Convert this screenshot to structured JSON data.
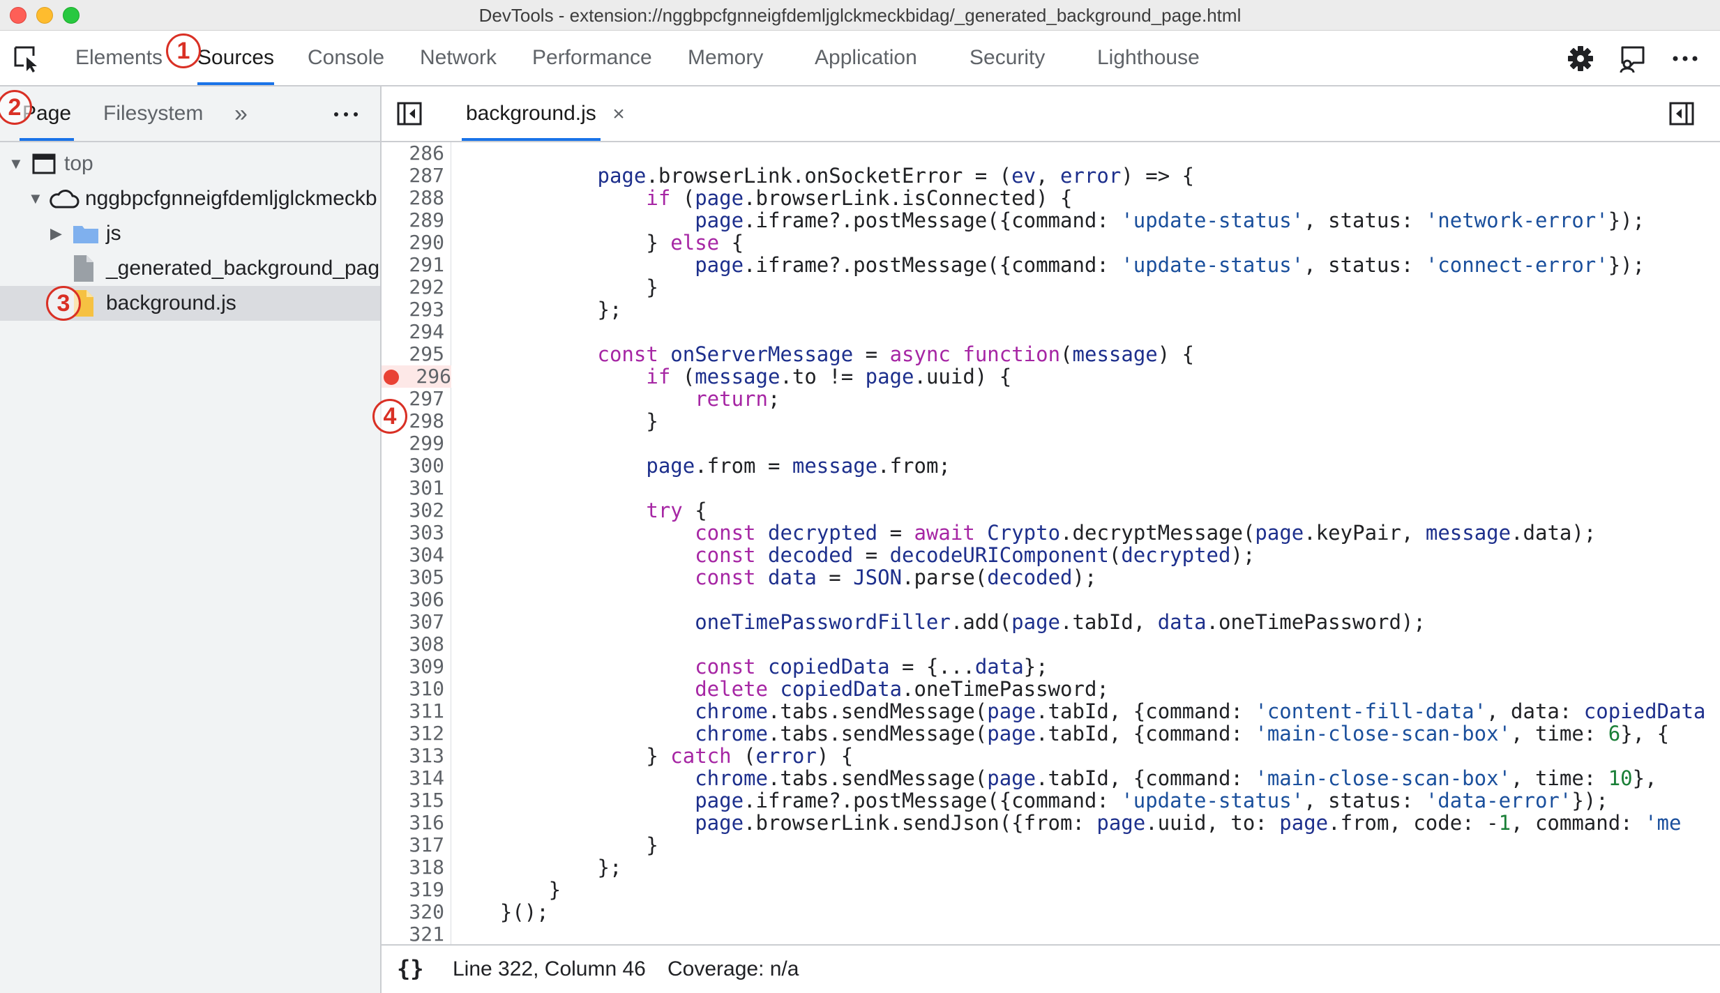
{
  "window": {
    "title": "DevTools - extension://nggbpcfgnneigfdemljglckmeckbidag/_generated_background_page.html"
  },
  "main_tabs": [
    {
      "label": "Elements"
    },
    {
      "label": "Sources"
    },
    {
      "label": "Console"
    },
    {
      "label": "Network"
    },
    {
      "label": "Performance"
    },
    {
      "label": "Memory"
    },
    {
      "label": "Application"
    },
    {
      "label": "Security"
    },
    {
      "label": "Lighthouse"
    }
  ],
  "active_main_tab": "Sources",
  "navigator": {
    "tabs": [
      {
        "label": "Page"
      },
      {
        "label": "Filesystem"
      }
    ],
    "more_tabs": "»",
    "tree": [
      {
        "label": "top",
        "icon": "frame-icon",
        "expanded": true
      },
      {
        "label": "nggbpcfgnneigfdemljglckmeckb",
        "icon": "cloud-icon",
        "expanded": true
      },
      {
        "label": "js",
        "icon": "folder-icon",
        "expanded": false
      },
      {
        "label": "_generated_background_pag",
        "icon": "file-icon"
      },
      {
        "label": "background.js",
        "icon": "js-file-icon",
        "selected": true
      }
    ]
  },
  "editor": {
    "open_file": "background.js",
    "close_glyph": "×",
    "breakpoint_line": 296,
    "line_numbers": [
      "286",
      "287",
      "288",
      "289",
      "290",
      "291",
      "292",
      "293",
      "294",
      "295",
      "296",
      "297",
      "298",
      "299",
      "300",
      "301",
      "302",
      "303",
      "304",
      "305",
      "306",
      "307",
      "308",
      "309",
      "310",
      "311",
      "312",
      "313",
      "314",
      "315",
      "316",
      "317",
      "318",
      "319",
      "320",
      "321"
    ]
  },
  "status": {
    "pretty_print": "{}",
    "position": "Line 322, Column 46",
    "coverage": "Coverage: n/a"
  },
  "callouts": [
    "1",
    "2",
    "3",
    "4"
  ],
  "colors": {
    "accent": "#1a73e8",
    "keyword": "#a626a4",
    "string": "#1a4f9c",
    "breakpoint": "#e94235",
    "callout": "#d93025"
  }
}
